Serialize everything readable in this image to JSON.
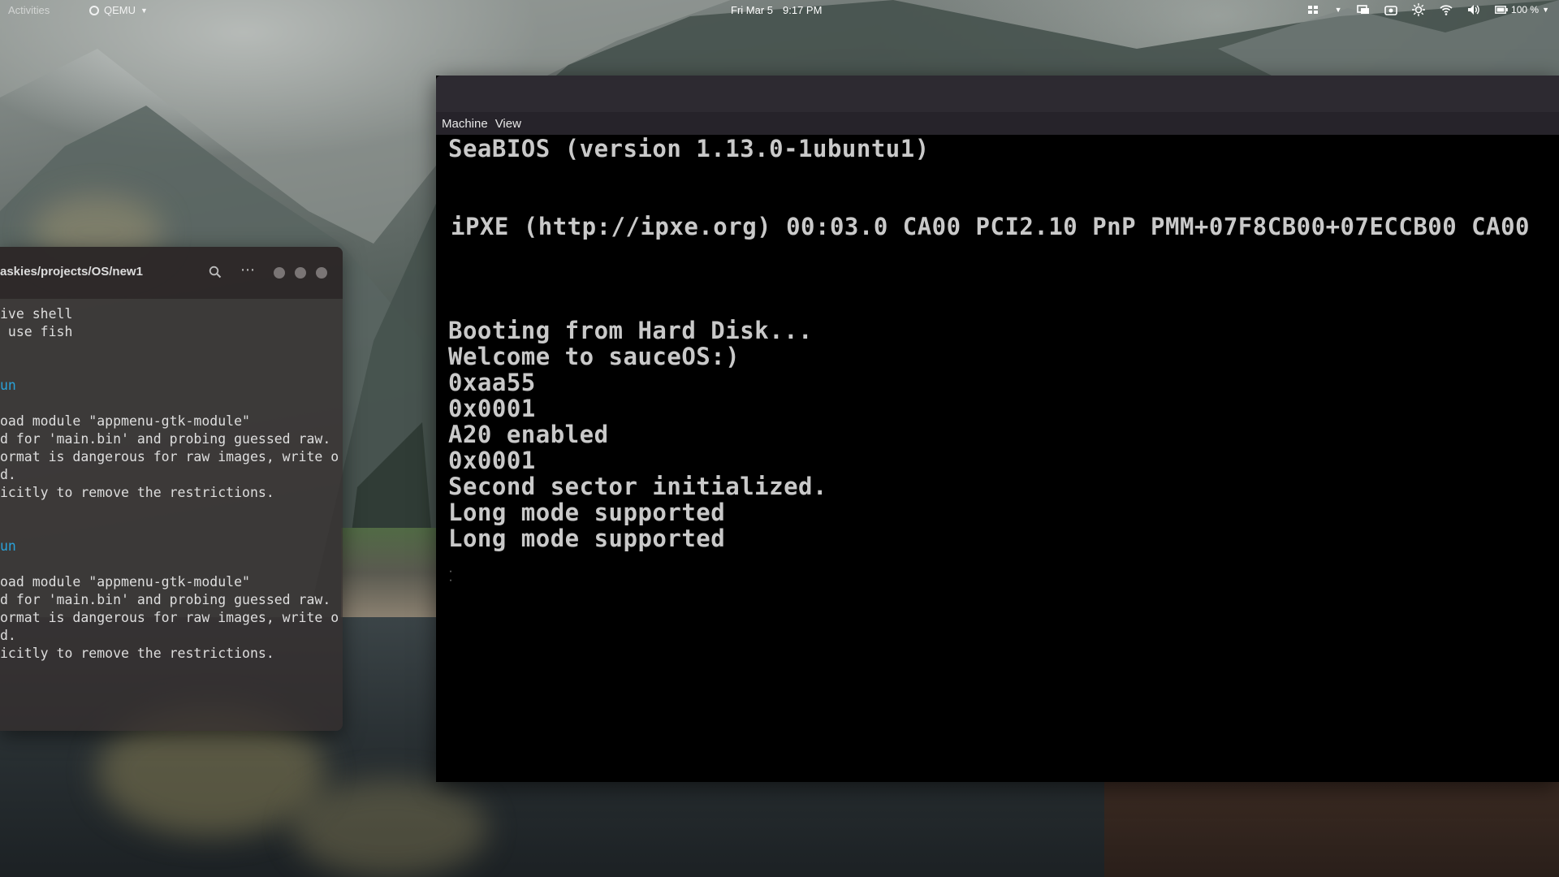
{
  "top_panel": {
    "activities": "Activities",
    "app_name": "QEMU",
    "date": "Fri Mar 5",
    "time": "9:17 PM",
    "battery": "100 %"
  },
  "terminal": {
    "title": "askies/projects/OS/new1",
    "lines": [
      "ive shell",
      " use fish",
      "",
      "",
      "un",
      "",
      "oad module \"appmenu-gtk-module\"",
      "d for 'main.bin' and probing guessed raw.",
      "ormat is dangerous for raw images, write o",
      "d.",
      "icitly to remove the restrictions.",
      "",
      "",
      "un",
      "",
      "oad module \"appmenu-gtk-module\"",
      "d for 'main.bin' and probing guessed raw.",
      "ormat is dangerous for raw images, write o",
      "d.",
      "icitly to remove the restrictions."
    ],
    "blue_line_indices": [
      4,
      13
    ]
  },
  "qemu": {
    "menu": [
      "Machine",
      "View"
    ],
    "screen_lines": [
      "SeaBIOS (version 1.13.0-1ubuntu1)",
      "iPXE (http://ipxe.org) 00:03.0 CA00 PCI2.10 PnP PMM+07F8CB00+07ECCB00 CA00",
      "Booting from Hard Disk...",
      "Welcome to sauceOS:)",
      "0xaa55",
      "0x0001",
      "A20 enabled",
      "0x0001",
      "Second sector initialized.",
      "Long mode supported",
      "Long mode supported"
    ]
  },
  "colors": {
    "terminal_accent": "#2aa1d8",
    "bios_text": "#c9c9c9",
    "qemu_titlebar": "#2d2a31"
  },
  "icons": [
    "settings-icon",
    "search-icon",
    "window-list-icon",
    "screen-icon",
    "camera-icon",
    "brightness-icon",
    "wifi-icon",
    "volume-icon",
    "battery-icon"
  ]
}
